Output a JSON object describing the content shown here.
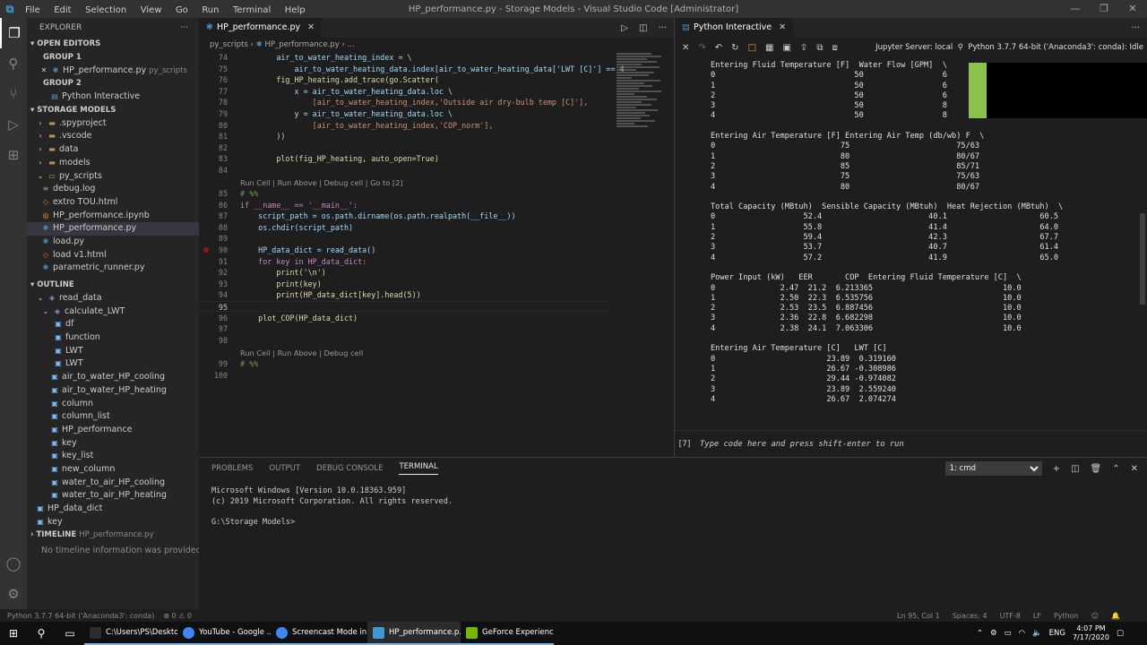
{
  "titlebar": {
    "menu": [
      "File",
      "Edit",
      "Selection",
      "View",
      "Go",
      "Run",
      "Terminal",
      "Help"
    ],
    "title": "HP_performance.py - Storage Models - Visual Studio Code [Administrator]"
  },
  "sidebar": {
    "title": "EXPLORER",
    "open_editors": "OPEN EDITORS",
    "group1": "GROUP 1",
    "group1_file": "HP_performance.py",
    "group1_file_desc": "py_scripts",
    "group2": "GROUP 2",
    "group2_file": "Python Interactive",
    "storage": "STORAGE MODELS",
    "files": [
      ".spyproject",
      ".vscode",
      "data",
      "models",
      "py_scripts",
      "debug.log",
      "extro TOU.html",
      "HP_performance.ipynb",
      "HP_performance.py",
      "load.py",
      "load v1.html",
      "parametric_runner.py"
    ],
    "outline": "OUTLINE",
    "outline_items": [
      "read_data",
      "calculate_LWT",
      "df",
      "function",
      "LWT",
      "LWT",
      "air_to_water_HP_cooling",
      "air_to_water_HP_heating",
      "column",
      "column_list",
      "HP_performance",
      "key",
      "key_list",
      "new_column",
      "water_to_air_HP_cooling",
      "water_to_air_HP_heating",
      "HP_data_dict",
      "key"
    ],
    "timeline": "TIMELINE",
    "timeline_desc": "HP_performance.py",
    "timeline_msg": "No timeline information was provided."
  },
  "editor": {
    "tab": "HP_performance.py",
    "crumb_folder": "py_scripts",
    "crumb_file": "HP_performance.py",
    "crumb_tail": "...",
    "lines": {
      "l74": "        air_to_water_heating_index = \\",
      "l75": "            air_to_water_heating_data.index[air_to_water_heating_data['LWT [C]'] == 4",
      "l76": "        fig_HP_heating.add_trace(go.Scatter(",
      "l77": "            x = air_to_water_heating_data.loc \\",
      "l78": "                [air_to_water_heating_index,'Outside air dry-bulb temp [C]'],",
      "l79": "            y = air_to_water_heating_data.loc \\",
      "l80": "                [air_to_water_heating_index,'COP_norm'],",
      "l81": "        ))",
      "l82": "",
      "l83": "        plot(fig_HP_heating, auto_open=True)",
      "l84": "",
      "l85": "# %%",
      "l86": "if __name__ == '__main__':",
      "l87": "    script_path = os.path.dirname(os.path.realpath(__file__))",
      "l88": "    os.chdir(script_path)",
      "l89": "",
      "l90": "    HP_data_dict = read_data()",
      "l91": "    for key in HP_data_dict:",
      "l92": "        print('\\n')",
      "l93": "        print(key)",
      "l94": "        print(HP_data_dict[key].head(5))",
      "l95": "",
      "l96": "    plot_COP(HP_data_dict)",
      "l97": "",
      "l98": "",
      "l99": "# %%",
      "l100": ""
    },
    "lens1": "Run Cell | Run Above | Debug cell | Go to [2]",
    "lens2": "Run Cell | Run Above | Debug cell"
  },
  "interactive": {
    "tab": "Python Interactive",
    "server": "Jupyter Server: local",
    "kernel": "Python 3.7.7 64-bit ('Anaconda3': conda): Idle",
    "tables": [
      "Entering Fluid Temperature [F]  Water Flow [GPM]  \\\n0                              50                 6\n1                              50                 6\n2                              50                 6\n3                              50                 8\n4                              50                 8",
      "Entering Air Temperature [F] Entering Air Temp (db/wb) F  \\\n0                           75                       75/63\n1                           80                       80/67\n2                           85                       85/71\n3                           75                       75/63\n4                           80                       80/67",
      "Total Capacity (MBtuh)  Sensible Capacity (MBtuh)  Heat Rejection (MBtuh)  \\\n0                   52.4                       40.1                    60.5\n1                   55.8                       41.4                    64.0\n2                   59.4                       42.3                    67.7\n3                   53.7                       40.7                    61.4\n4                   57.2                       41.9                    65.0",
      "Power Input (kW)   EER       COP  Entering Fluid Temperature [C]  \\\n0              2.47  21.2  6.213365                            10.0\n1              2.50  22.3  6.535756                            10.0\n2              2.53  23.5  6.887456                            10.0\n3              2.36  22.8  6.682298                            10.0\n4              2.38  24.1  7.063306                            10.0",
      "Entering Air Temperature [C]   LWT [C]\n0                        23.89  0.319160\n1                        26.67 -0.308986\n2                        29.44 -0.974082\n3                        23.89  2.559240\n4                        26.67  2.074274"
    ],
    "exec_count": "[7]",
    "input_placeholder": "Type code here and press shift-enter to run"
  },
  "panel": {
    "tabs": [
      "PROBLEMS",
      "OUTPUT",
      "DEBUG CONSOLE",
      "TERMINAL"
    ],
    "terminal_select": "1: cmd",
    "terminal": "Microsoft Windows [Version 10.0.18363.959]\n(c) 2019 Microsoft Corporation. All rights reserved.\n\nG:\\Storage Models>"
  },
  "statusbar": {
    "interpreter": "Python 3.7.7 64-bit ('Anaconda3': conda)",
    "problems": "⊗ 0 ⚠ 0",
    "position": "Ln 95, Col 1",
    "spaces": "Spaces: 4",
    "encoding": "UTF-8",
    "eol": "LF",
    "language": "Python"
  },
  "taskbar": {
    "apps": [
      {
        "label": "C:\\Users\\PS\\Deskto...",
        "color": "#2d2d2d"
      },
      {
        "label": "YouTube - Google ...",
        "color": "#4285f4"
      },
      {
        "label": "Screencast Mode in...",
        "color": "#4285f4"
      },
      {
        "label": "HP_performance.p...",
        "color": "#3c99d4"
      },
      {
        "label": "GeForce Experience",
        "color": "#76b900"
      }
    ],
    "lang": "ENG",
    "time": "4:07 PM",
    "date": "7/17/2020"
  }
}
